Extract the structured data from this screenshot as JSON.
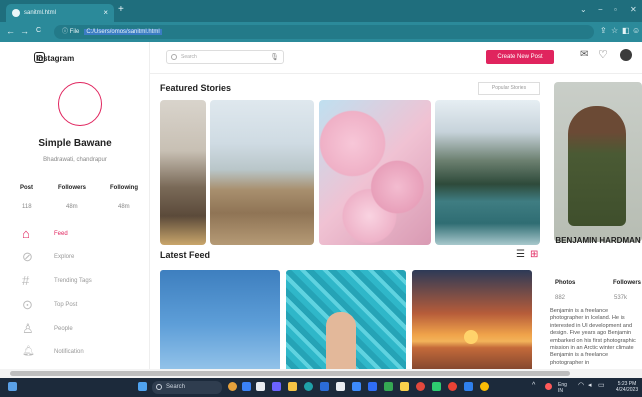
{
  "browser": {
    "tab_title": "sanitml.html",
    "tab_close": "×",
    "new_tab": "+",
    "window_controls": [
      "⌄",
      "−",
      "▫",
      "✕"
    ],
    "nav": [
      "←",
      "→",
      "C"
    ],
    "address_prefix": "ⓘ File",
    "address_url": "C:/Users/omos/sanitml.html",
    "tools": [
      "⇪",
      "☆",
      "◧",
      "☺"
    ]
  },
  "app": {
    "brand": "Instagram",
    "search": {
      "placeholder": "Search",
      "mic": "🎙"
    },
    "new_post_label": "Create New Post",
    "top_icons": {
      "messages": "✉",
      "likes": "♡"
    }
  },
  "profile_card": {
    "name": "Simple Bawane",
    "location": "Bhadrawati, chandrapur",
    "stats": [
      {
        "label": "Post",
        "value": "118"
      },
      {
        "label": "Followers",
        "value": "48m"
      },
      {
        "label": "Following",
        "value": "48m"
      }
    ]
  },
  "menu": [
    {
      "label": "Feed",
      "icon": "⌂",
      "active": true
    },
    {
      "label": "Explore",
      "icon": "⊘",
      "active": false
    },
    {
      "label": "Trending Tags",
      "icon": "#",
      "active": false
    },
    {
      "label": "Top Post",
      "icon": "⊙",
      "active": false
    },
    {
      "label": "People",
      "icon": "♙",
      "active": false
    },
    {
      "label": "Notification",
      "icon": "🔔︎",
      "active": false
    }
  ],
  "featured": {
    "title": "Featured Stories",
    "popular_label": "Popular Stories"
  },
  "latest": {
    "title": "Latest Feed",
    "list_icon": "☰",
    "grid_icon": "⊞"
  },
  "featured_person": {
    "name": "BENJAMIN HARDMAN",
    "stats": [
      {
        "label": "Photos",
        "value": "882"
      },
      {
        "label": "Followers",
        "value": "537k"
      }
    ],
    "bio": "Benjamin is a freelance photographer in Iceland. He is interested in UI development and design. Five years ago Benjamin embarked on his first photographic mission in an Arctic winter climate Benjamin is a freelance photographer in"
  },
  "taskbar": {
    "search_label": "Search",
    "tray_weather": "Eng IN",
    "tray_time": "5:23 PM",
    "tray_date": "4/24/2023"
  },
  "colors": {
    "accent": "#e0245e",
    "browser_chrome": "#2b8a9a",
    "taskbar": "#1c2a3b"
  }
}
